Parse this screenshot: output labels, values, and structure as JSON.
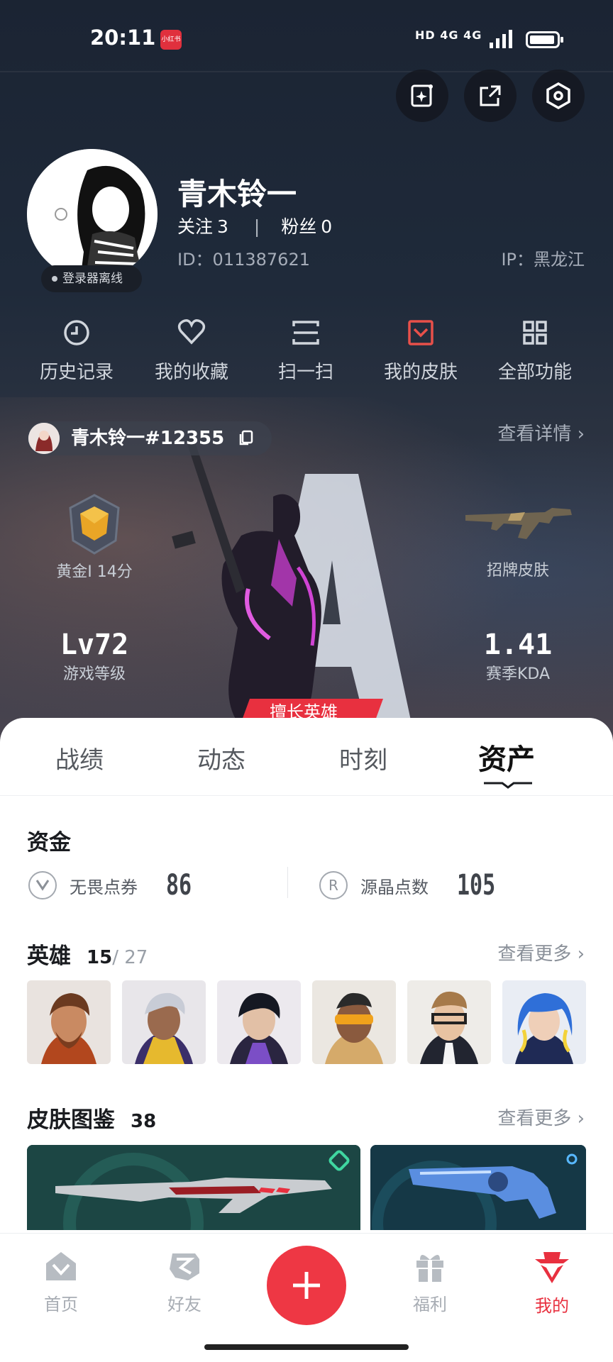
{
  "status_bar": {
    "time": "20:11",
    "app_badge": "小红书",
    "network": "HD 4G 4G"
  },
  "top_actions": [
    {
      "icon": "sparkle-card-icon"
    },
    {
      "icon": "share-icon"
    },
    {
      "icon": "settings-hexagon-icon"
    }
  ],
  "profile": {
    "name": "青木铃一",
    "follow_label": "关注",
    "follow_count": "3",
    "separator": "|",
    "fans_label": "粉丝",
    "fans_count": "0",
    "id_text": "ID：011387621",
    "ip_text": "IP：黑龙江",
    "status": "登录器离线"
  },
  "shortcuts": [
    {
      "label": "历史记录",
      "icon": "history-icon"
    },
    {
      "label": "我的收藏",
      "icon": "heart-icon"
    },
    {
      "label": "扫一扫",
      "icon": "scan-icon"
    },
    {
      "label": "我的皮肤",
      "icon": "skin-icon",
      "color": "#e8504a"
    },
    {
      "label": "全部功能",
      "icon": "grid-icon"
    }
  ],
  "game": {
    "tag": "青木铃一#12355",
    "detail": "查看详情 ›",
    "rank": "黄金I 14分",
    "signature_skin": "招牌皮肤",
    "level_value": "Lv72",
    "level_label": "游戏等级",
    "kda_value": "1.41",
    "kda_label": "赛季KDA",
    "hero_banner": "擅长英雄"
  },
  "tabs": [
    {
      "label": "战绩"
    },
    {
      "label": "动态"
    },
    {
      "label": "时刻"
    },
    {
      "label": "资产",
      "active": true
    }
  ],
  "assets": {
    "funds_title": "资金",
    "funds": [
      {
        "icon": "valor-point-icon",
        "label": "无畏点券",
        "value": "86"
      },
      {
        "icon": "radianite-icon",
        "label": "源晶点数",
        "value": "105"
      }
    ],
    "heroes_title": "英雄",
    "heroes_owned": "15",
    "heroes_total": "/ 27",
    "heroes_more": "查看更多 ›",
    "heroes": [
      {
        "name": "hero-1"
      },
      {
        "name": "hero-2"
      },
      {
        "name": "hero-3"
      },
      {
        "name": "hero-4"
      },
      {
        "name": "hero-5"
      },
      {
        "name": "hero-6"
      }
    ],
    "skins_title": "皮肤图鉴",
    "skins_count": "38",
    "skins_more": "查看更多 ›"
  },
  "bottom_nav": [
    {
      "label": "首页",
      "icon": "home-icon"
    },
    {
      "label": "好友",
      "icon": "friends-icon"
    },
    {
      "label": "",
      "icon": "plus-icon"
    },
    {
      "label": "福利",
      "icon": "gift-icon"
    },
    {
      "label": "我的",
      "icon": "me-icon",
      "active": true
    }
  ],
  "colors": {
    "accent": "#e8303f",
    "hero_bg": "#1f2a3a"
  }
}
